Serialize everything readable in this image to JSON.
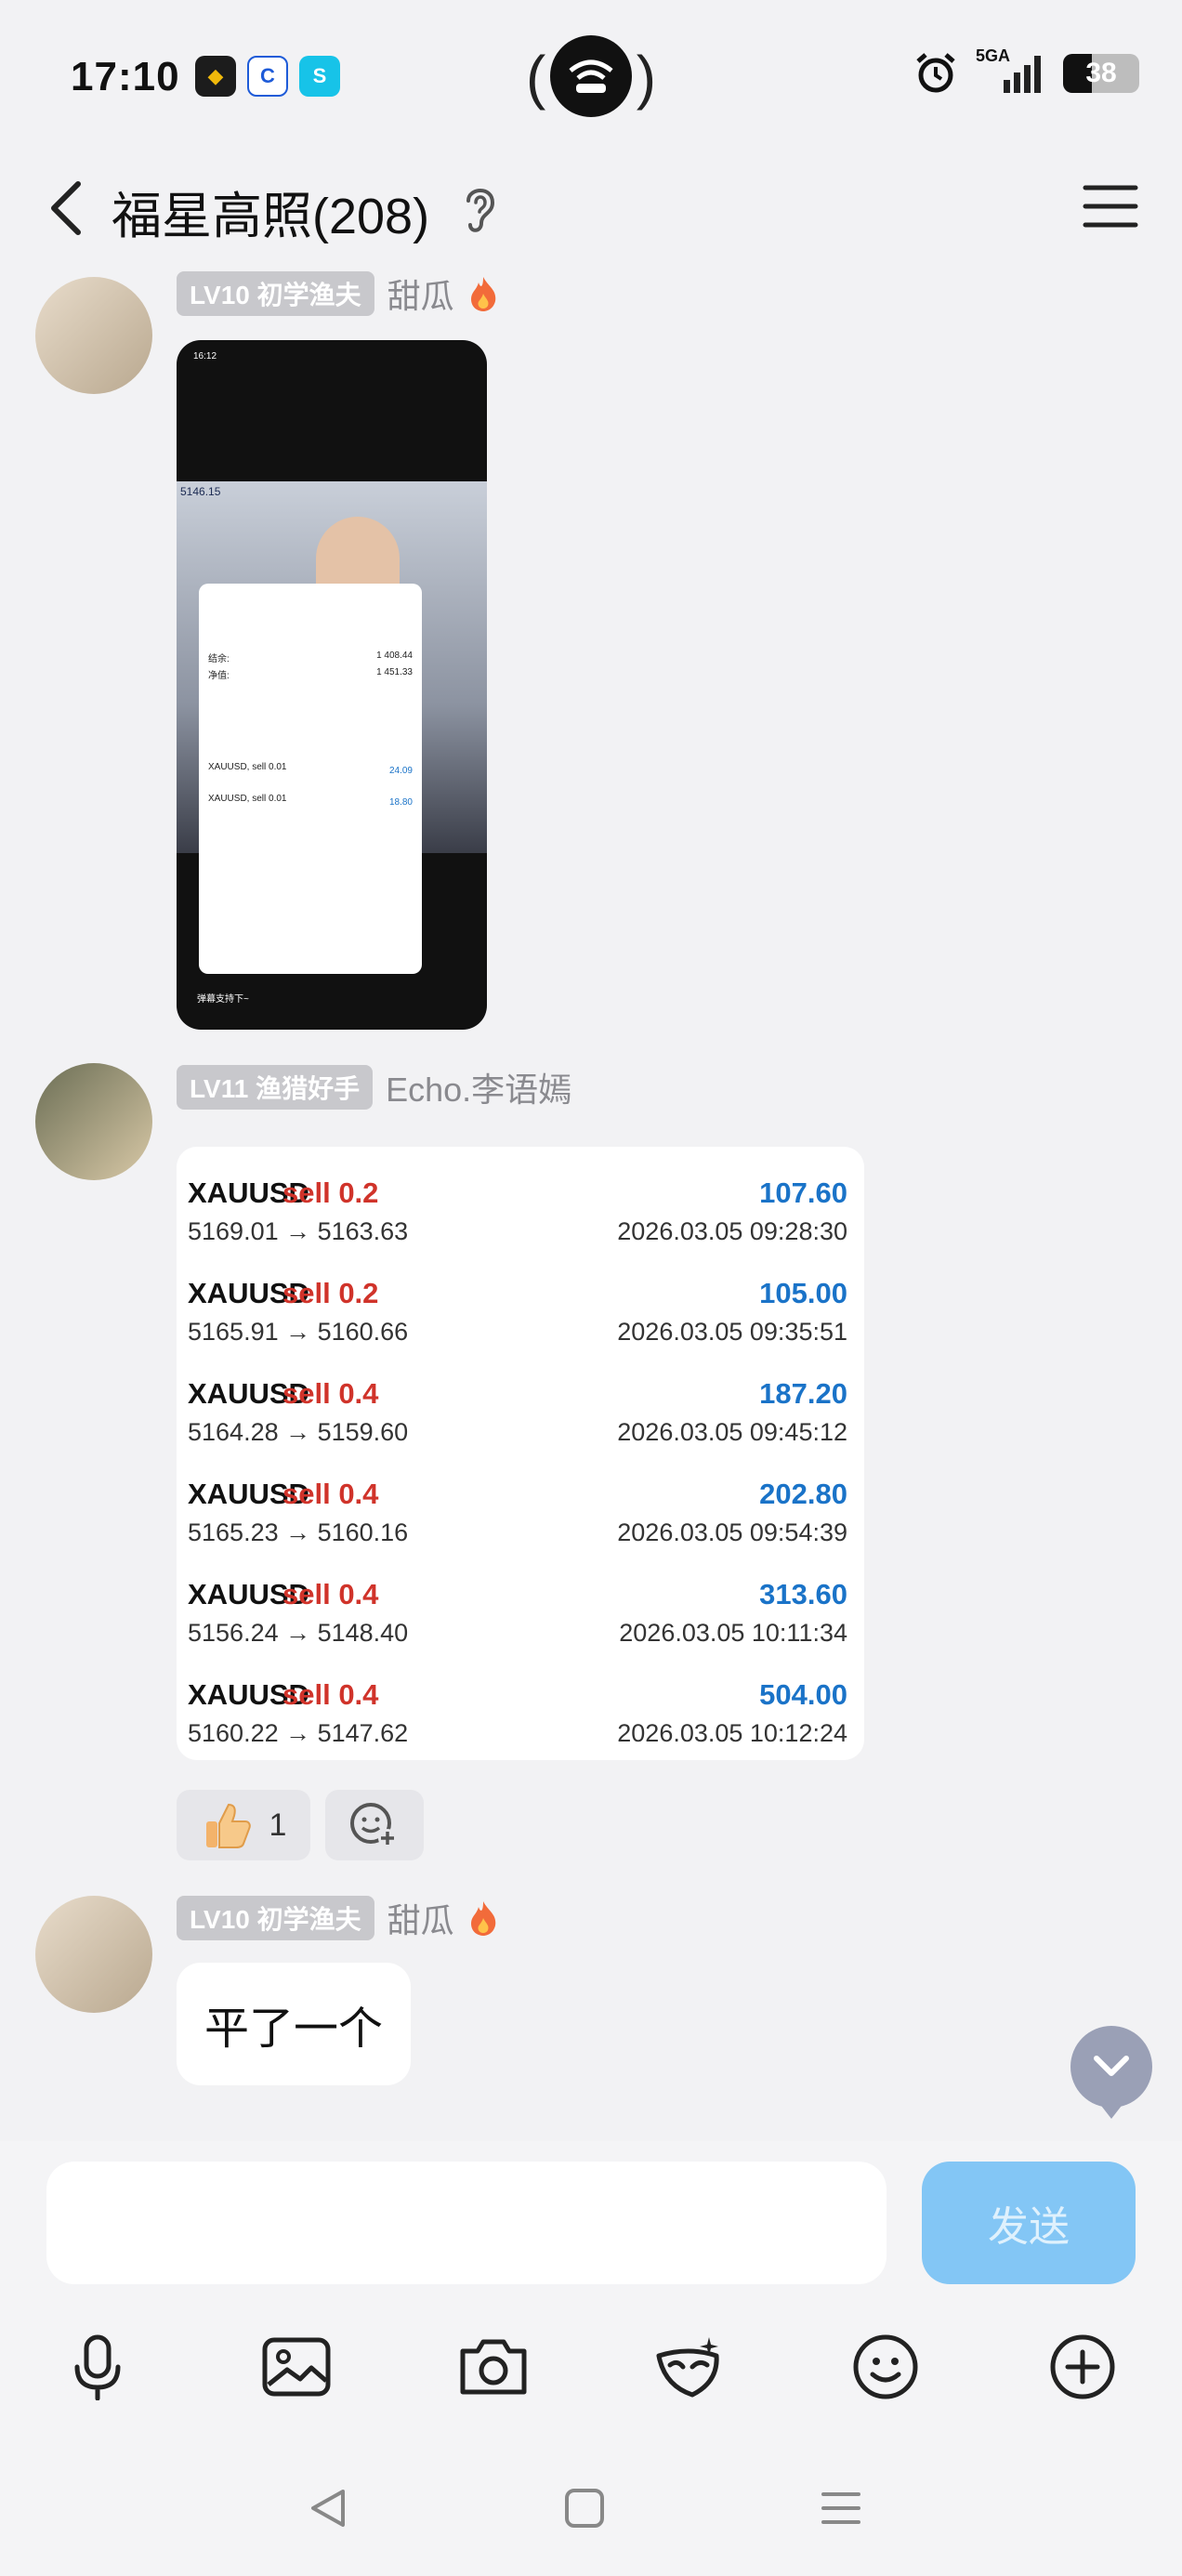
{
  "status_bar": {
    "time": "17:10",
    "app_icons": [
      "binance-icon",
      "app-icon",
      "app-icon"
    ],
    "app_icon_glyphs": [
      "◆",
      "C",
      "S"
    ],
    "network_label": "5GA",
    "battery": "38",
    "battery_level": 0.38,
    "icons": [
      "hotspot-icon",
      "alarm-icon",
      "signal-icon",
      "battery-icon"
    ]
  },
  "header": {
    "title": "福星高照(208)",
    "icons": [
      "back-icon",
      "ear-icon",
      "menu-icon"
    ]
  },
  "messages": [
    {
      "level": "LV10 初学渔夫",
      "nick": "甜瓜",
      "type": "screenshot",
      "screenshot": {
        "time": "16:12",
        "stream_text": "5146.15",
        "panel_text": [
          "结余:",
          "1 408.44",
          "净值:",
          "1 451.33",
          "XAUUSD, sell 0.01",
          "24.09",
          "XAUUSD, sell 0.01",
          "18.80"
        ],
        "comment": "弹幕支持下~"
      }
    },
    {
      "level": "LV11 渔猎好手",
      "nick": "Echo.李语嫣",
      "type": "trades",
      "trades": [
        {
          "symbol": "XAUUSD",
          "side": "sell 0.2",
          "profit": "107.60",
          "price": "5169.01 → 5163.63",
          "time": "2026.03.05 09:28:30"
        },
        {
          "symbol": "XAUUSD",
          "side": "sell 0.2",
          "profit": "105.00",
          "price": "5165.91 → 5160.66",
          "time": "2026.03.05 09:35:51"
        },
        {
          "symbol": "XAUUSD",
          "side": "sell 0.4",
          "profit": "187.20",
          "price": "5164.28 → 5159.60",
          "time": "2026.03.05 09:45:12"
        },
        {
          "symbol": "XAUUSD",
          "side": "sell 0.4",
          "profit": "202.80",
          "price": "5165.23 → 5160.16",
          "time": "2026.03.05 09:54:39"
        },
        {
          "symbol": "XAUUSD",
          "side": "sell 0.4",
          "profit": "313.60",
          "price": "5156.24 → 5148.40",
          "time": "2026.03.05 10:11:34"
        },
        {
          "symbol": "XAUUSD",
          "side": "sell 0.4",
          "profit": "504.00",
          "price": "5160.22 → 5147.62",
          "time": "2026.03.05 10:12:24"
        }
      ],
      "reactions": {
        "like_count": "1"
      }
    },
    {
      "level": "LV10 初学渔夫",
      "nick": "甜瓜",
      "type": "text",
      "text": "平了一个"
    }
  ],
  "input": {
    "value": "",
    "placeholder": ""
  },
  "send_label": "发送",
  "toolbar": [
    "mic-icon",
    "image-icon",
    "camera-icon",
    "mask-icon",
    "emoji-icon",
    "plus-icon"
  ],
  "navbar": [
    "nav-back-icon",
    "nav-home-icon",
    "nav-recents-icon"
  ],
  "colors": {
    "accent": "#83c6f5",
    "profit": "#1a73c8",
    "sell": "#d0332a",
    "badge": "#c8c8cc"
  }
}
